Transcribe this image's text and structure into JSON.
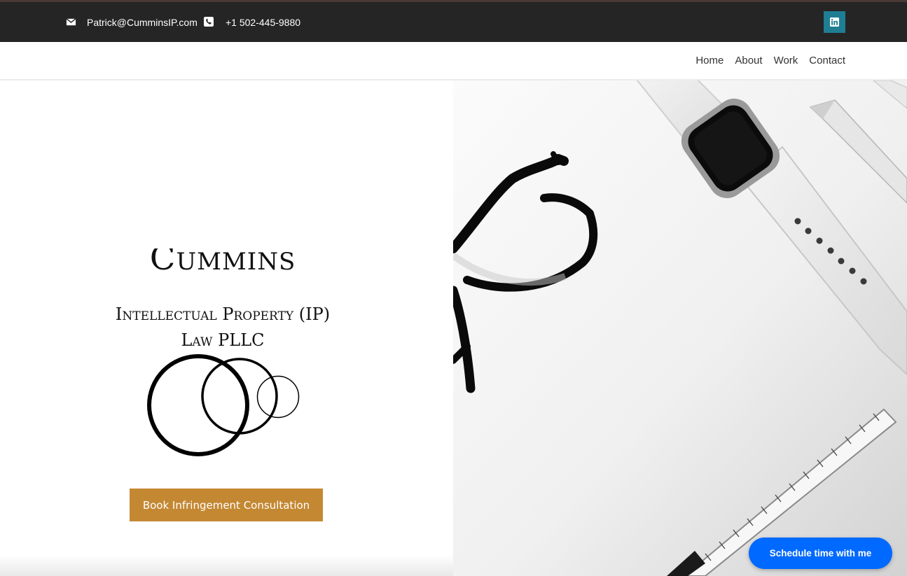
{
  "topbar": {
    "email": "Patrick@CumminsIP.com",
    "phone": "+1 502-445-9880",
    "icons": {
      "email": "envelope-icon",
      "phone": "phone-icon",
      "social": "linkedin-icon"
    }
  },
  "nav": {
    "items": [
      {
        "label": "Home"
      },
      {
        "label": "About"
      },
      {
        "label": "Work"
      },
      {
        "label": "Contact"
      }
    ]
  },
  "logo": {
    "line1": "Cummins",
    "line2": "Intellectual Property (IP)",
    "line3": "Law PLLC"
  },
  "hero": {
    "cta_label": "Book Infringement Consultation",
    "image_subject": "glasses, smartwatch, pencil and ruler on white desk"
  },
  "schedule_button": {
    "label": "Schedule time with me"
  },
  "colors": {
    "topbar": "#252525",
    "linkedin": "#1f7e93",
    "cta": "#c48833",
    "schedule": "#0069ff"
  }
}
